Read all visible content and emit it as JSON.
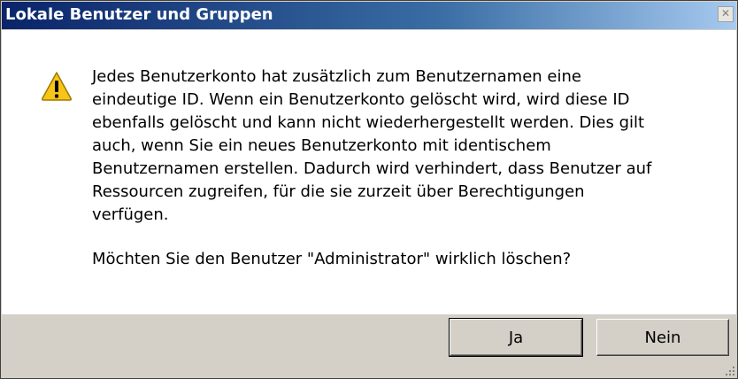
{
  "window": {
    "title": "Lokale Benutzer und Gruppen",
    "close_glyph": "✕"
  },
  "icon": "warning-icon",
  "message": {
    "body": "Jedes Benutzerkonto hat zusätzlich zum Benutzernamen eine\neindeutige ID. Wenn ein Benutzerkonto gelöscht wird, wird diese ID\nebenfalls gelöscht und kann nicht wiederhergestellt werden. Dies gilt\nauch, wenn Sie ein neues Benutzerkonto mit identischem\nBenutzernamen erstellen. Dadurch wird verhindert, dass Benutzer auf\nRessourcen zugreifen, für die sie zurzeit über Berechtigungen\nverfügen.",
    "question": "Möchten Sie den Benutzer \"Administrator\" wirklich löschen?"
  },
  "buttons": {
    "yes_label": "Ja",
    "no_label": "Nein"
  },
  "colors": {
    "title_gradient_start": "#0a246a",
    "title_gradient_end": "#a6caf0",
    "warning_yellow": "#f5c518"
  }
}
